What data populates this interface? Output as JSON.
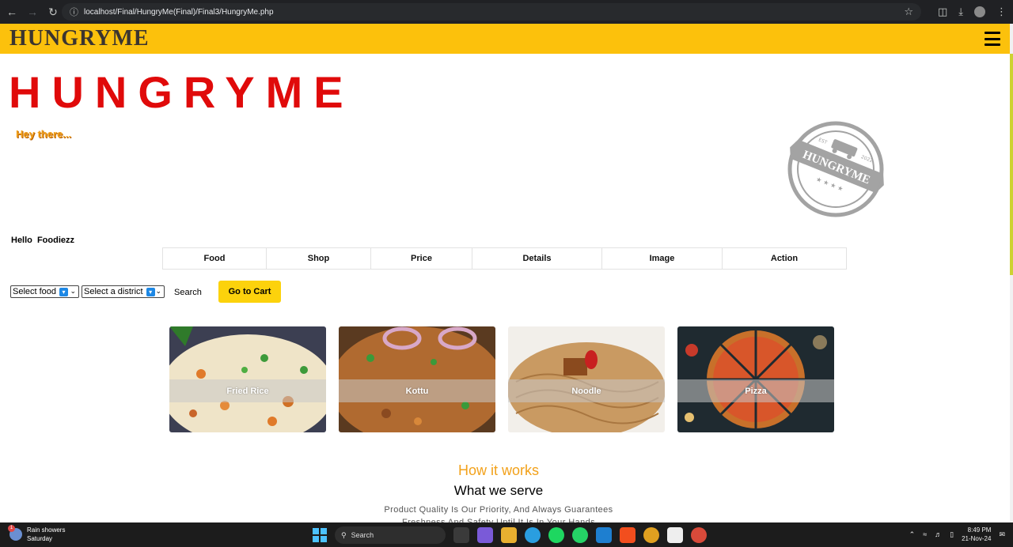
{
  "browser": {
    "url": "localhost/Final/HungryMe(Final)/Final3/HungryMe.php"
  },
  "header": {
    "brand": "HUNGRYME"
  },
  "hero": {
    "title": "HUNGRYME",
    "greeting": "Hey there...",
    "stamp_text": "HUNGRYME",
    "stamp_est": "EST",
    "stamp_year": "2022"
  },
  "main": {
    "hello": "Hello Foodiezz",
    "table_headers": [
      "Food",
      "Shop",
      "Price",
      "Details",
      "Image",
      "Action"
    ],
    "select_food": "Select food",
    "select_district": "Select a district",
    "search_label": "Search",
    "cart_label": "Go to Cart"
  },
  "cards": [
    {
      "label": "Fried Rice"
    },
    {
      "label": "Kottu"
    },
    {
      "label": "Noodle"
    },
    {
      "label": "Pizza"
    }
  ],
  "how": {
    "title": "How it works",
    "subtitle": "What we serve",
    "line1": "Product Quality Is Our Priority, And Always Guarantees",
    "line2": "Freshness And Safety Until It Is In Your Hands"
  },
  "taskbar": {
    "weather_title": "Rain showers",
    "weather_day": "Saturday",
    "weather_badge": "1",
    "search": "Search",
    "time": "8:49 PM",
    "date": "21-Nov-24"
  },
  "colors": {
    "header_yellow": "#fcc10c",
    "title_red": "#e00a0a",
    "accent_orange": "#f2a11a",
    "cart_yellow": "#fcd20c"
  }
}
